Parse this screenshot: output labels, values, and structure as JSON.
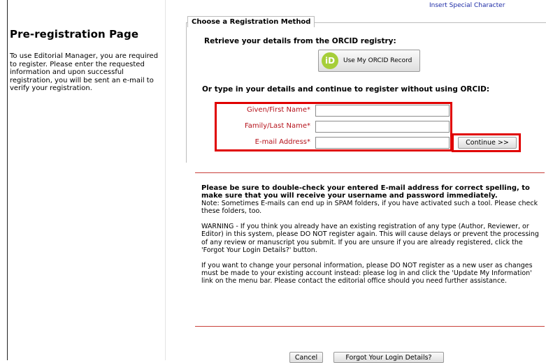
{
  "sidebar": {
    "title": "Pre-registration Page",
    "description": "To use Editorial Manager, you are required to register. Please enter the requested information and upon successful registration, you will be sent an e-mail to verify your registration."
  },
  "header": {
    "insert_char": "Insert Special Character"
  },
  "section": {
    "legend": "Choose a Registration Method",
    "orcid_prompt": "Retrieve your details from the ORCID registry:",
    "orcid_button": "Use My ORCID Record",
    "orcid_logo_text": "iD",
    "or_prompt": "Or type in your details and continue to register without using ORCID:"
  },
  "form": {
    "first_name_label": "Given/First Name*",
    "last_name_label": "Family/Last Name*",
    "email_label": "E-mail Address*",
    "first_name_value": "",
    "last_name_value": "",
    "email_value": "",
    "continue_button": "Continue >>"
  },
  "notice": {
    "bold_text": "Please be sure to double-check your entered E-mail address for correct spelling, to make sure that you will receive your username and password immediately.",
    "note": "Note: Sometimes E-mails can end up in SPAM folders, if you have activated such a tool. Please check these folders, too.",
    "warning": "WARNING - If you think you already have an existing registration of any type (Author, Reviewer, or Editor) in this system, please DO NOT register again. This will cause delays or prevent the processing of any review or manuscript you submit. If you are unsure if you are already registered, click the 'Forgot Your Login Details?' button.",
    "change_info": "If you want to change your personal information, please DO NOT register as a new user as changes must be made to your existing account instead: please log in and click the 'Update My Information' link on the menu bar. Please contact the editorial office should you need further assistance."
  },
  "footer": {
    "cancel_button": "Cancel",
    "forgot_button": "Forgot Your Login Details?"
  },
  "colors": {
    "label_red": "#b5121b",
    "highlight_red": "#e00000",
    "orcid_green": "#a6ce39",
    "link_blue": "#1c2aa6"
  }
}
